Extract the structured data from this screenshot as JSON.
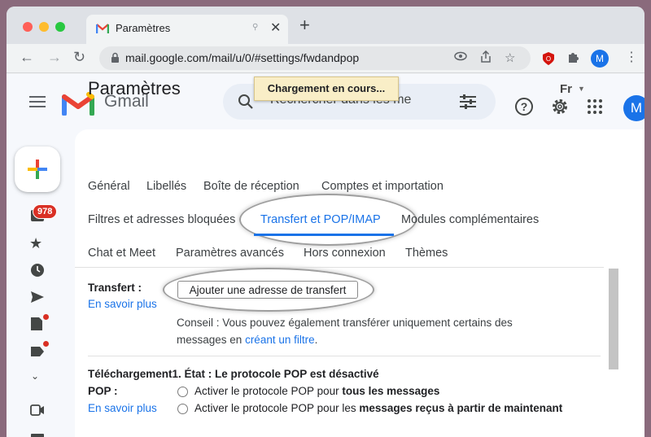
{
  "browser": {
    "tab_title": "Paramètres",
    "tab_extra": "⚲",
    "new_tab_label": "+",
    "url": "mail.google.com/mail/u/0/#settings/fwdandpop",
    "profile_initial": "M"
  },
  "header": {
    "app_name": "Gmail",
    "search_placeholder": "Rechercher dans les me",
    "avatar_initial": "M"
  },
  "tooltip": "Chargement en cours...",
  "rail": {
    "inbox_count": "978"
  },
  "settings": {
    "title": "Paramètres",
    "language": "Fr",
    "tabs_row1": [
      "Général",
      "Libellés",
      "Boîte de réception",
      "Comptes et importation"
    ],
    "tabs_row2": [
      "Filtres et adresses bloquées",
      "Transfert et POP/IMAP",
      "Modules complémentaires"
    ],
    "tabs_row3": [
      "Chat et Meet",
      "Paramètres avancés",
      "Hors connexion",
      "Thèmes"
    ],
    "active_tab": "Transfert et POP/IMAP"
  },
  "forwarding": {
    "label": "Transfert :",
    "learn_more": "En savoir plus",
    "add_button": "Ajouter une adresse de transfert",
    "tip_line1": "Conseil : Vous pouvez également transférer uniquement certains des",
    "tip_line2_prefix": "messages en",
    "tip_link": "créant un filtre",
    "tip_line2_suffix": "."
  },
  "pop": {
    "status_heading": "Téléchargement1. État : Le protocole POP est désactivé",
    "label": "POP :",
    "learn_more": "En savoir plus",
    "option1_prefix": "Activer le protocole POP pour",
    "option1_bold": "tous les messages",
    "option2_prefix": "Activer le protocole POP pour les",
    "option2_bold": "messages reçus à partir de maintenant"
  },
  "colors": {
    "accent": "#1a73e8",
    "badge": "#d93025",
    "tooltip_bg": "#f9eec7"
  }
}
